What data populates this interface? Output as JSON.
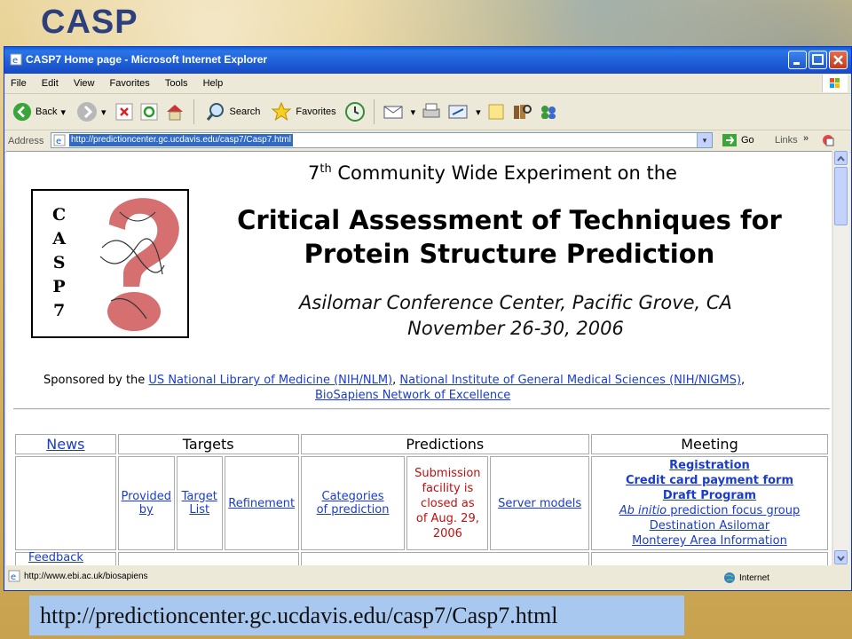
{
  "slide": {
    "title": "CASP",
    "bottom_url": "http://predictioncenter.gc.ucdavis.edu/casp7/Casp7.html"
  },
  "window": {
    "title": "CASP7 Home page - Microsoft Internet Explorer",
    "menu": [
      "File",
      "Edit",
      "View",
      "Favorites",
      "Tools",
      "Help"
    ],
    "toolbar": {
      "back": "Back",
      "search": "Search",
      "favorites": "Favorites"
    },
    "address": {
      "label": "Address",
      "value": "http://predictioncenter.gc.ucdavis.edu/casp7/Casp7.html",
      "go": "Go",
      "links": "Links"
    },
    "status": {
      "url": "http://www.ebi.ac.uk/biosapiens",
      "zone": "Internet"
    }
  },
  "page": {
    "logo_letters": [
      "C",
      "A",
      "S",
      "P",
      "7"
    ],
    "edition_num": "7",
    "edition_sup": "th",
    "edition_rest": " Community Wide Experiment on the",
    "title_line1": "Critical Assessment of Techniques for",
    "title_line2": "Protein Structure Prediction",
    "venue_line1": "Asilomar Conference Center, Pacific Grove, CA",
    "venue_line2": "November 26-30, 2006",
    "sponsor_prefix": "Sponsored by the ",
    "sponsor_link1": "US National Library of Medicine (NIH/NLM)",
    "sponsor_sep": ", ",
    "sponsor_link2": "National Institute of General Medical Sciences (NIH/NIGMS)",
    "sponsor_end": ",",
    "sponsor_link3": "BioSapiens Network of Excellence"
  },
  "table": {
    "news": "News",
    "targets": "Targets",
    "predictions": "Predictions",
    "meeting": "Meeting",
    "provided_by": [
      "Provided",
      "by"
    ],
    "target_list": [
      "Target",
      "List"
    ],
    "refinement": "Refinement",
    "categories": [
      "Categories",
      "of prediction"
    ],
    "submission": [
      "Submission",
      "facility is",
      "closed as",
      "of Aug. 29,",
      "2006"
    ],
    "server_models": "Server models",
    "meeting_links": {
      "registration": "Registration",
      "credit": "Credit card payment form",
      "draft": "Draft Program",
      "abinitio_em": "Ab initio",
      "abinitio_rest": " prediction focus group",
      "destination": "Destination Asilomar",
      "monterey": "Monterey Area Information"
    },
    "feedback": "Feedback"
  }
}
